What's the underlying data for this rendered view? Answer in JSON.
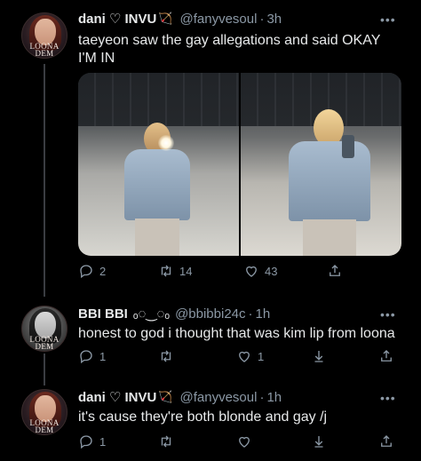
{
  "tweets": [
    {
      "display_name": "dani",
      "badge": "♡ INVU",
      "emoji": "🏹",
      "handle": "@fanyvesoul",
      "time": "3h",
      "text_line1": "taeyeon saw the gay allegations and said OKAY",
      "text_line2": "I'M IN",
      "avatar_text_line1": "LOONA",
      "avatar_text_line2": "DEM",
      "replies": "2",
      "retweets": "14",
      "likes": "43"
    },
    {
      "display_name": "BBI BBI",
      "badge": "ₒ◌‿◌ₒ",
      "emoji": "",
      "handle": "@bbibbi24c",
      "time": "1h",
      "text_line1": "honest to god i thought that was kim lip from loona",
      "avatar_text_line1": "LOONA",
      "avatar_text_line2": "DEM",
      "replies": "1",
      "retweets": "",
      "likes": "1"
    },
    {
      "display_name": "dani",
      "badge": "♡ INVU",
      "emoji": "🏹",
      "handle": "@fanyvesoul",
      "time": "1h",
      "text_line1": "it's cause they're both blonde and gay /j",
      "avatar_text_line1": "LOONA",
      "avatar_text_line2": "DEM",
      "replies": "1",
      "retweets": "",
      "likes": ""
    }
  ],
  "separator": "·",
  "more_label": "•••",
  "icons": [
    "reply-icon",
    "retweet-icon",
    "like-icon",
    "share-icon",
    "more-icon"
  ]
}
